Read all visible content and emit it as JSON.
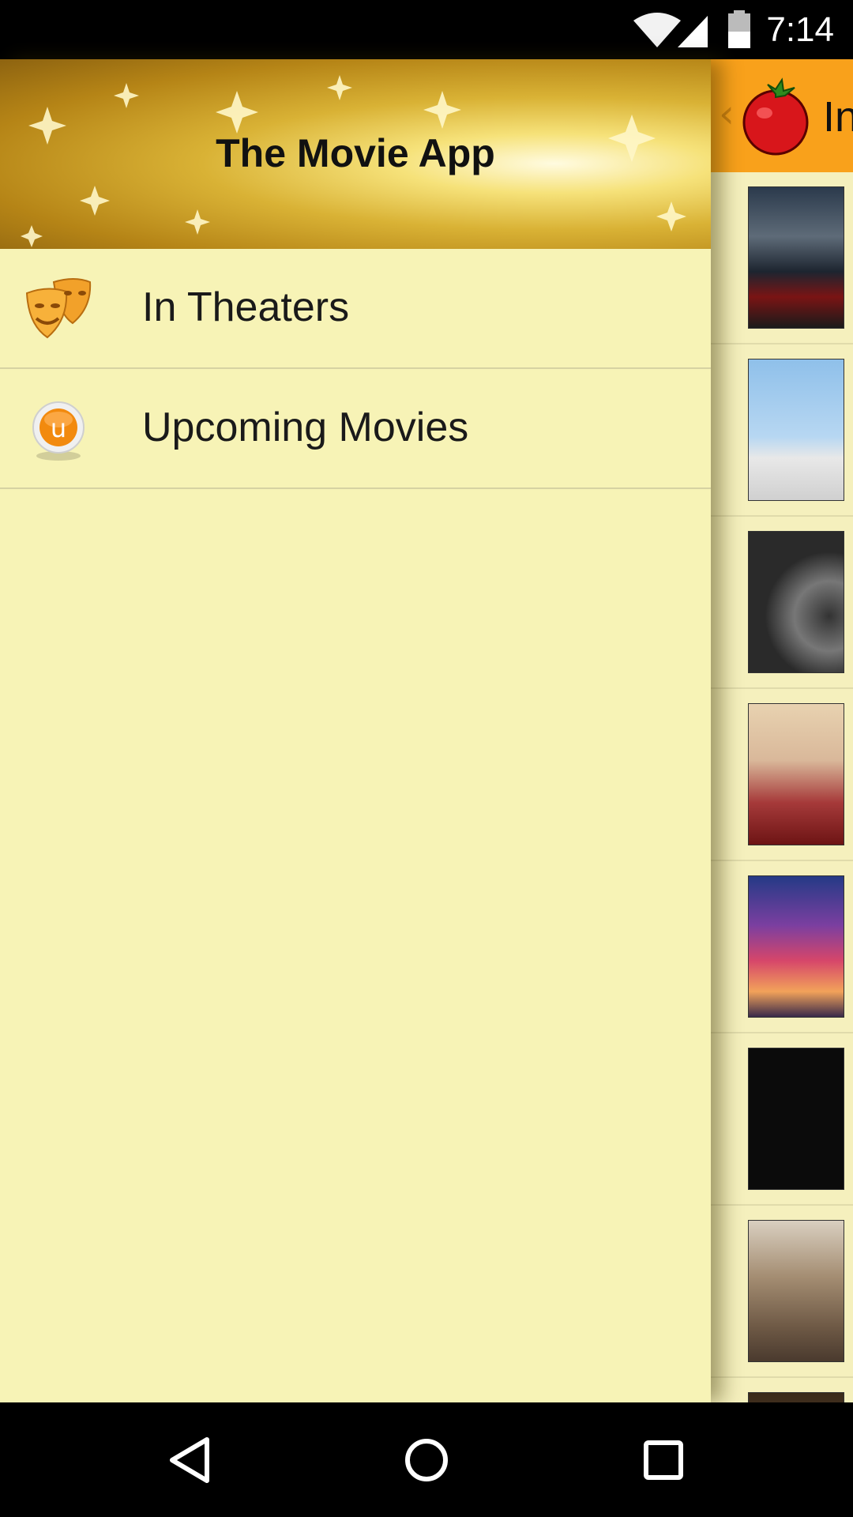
{
  "status_bar": {
    "time": "7:14",
    "icons": [
      "wifi-icon",
      "cell-signal-icon",
      "battery-icon"
    ]
  },
  "drawer": {
    "title": "The Movie App",
    "items": [
      {
        "label": "In Theaters",
        "icon": "theater-masks-icon"
      },
      {
        "label": "Upcoming Movies",
        "icon": "upcoming-u-icon"
      }
    ]
  },
  "background_app": {
    "toolbar_title": "In",
    "logo": "tomato-logo-icon",
    "posters": [
      "movie-poster-1",
      "movie-poster-2",
      "movie-poster-3",
      "movie-poster-4",
      "movie-poster-5",
      "movie-poster-6",
      "movie-poster-7",
      "movie-poster-8"
    ]
  },
  "nav_bar": {
    "buttons": [
      "back-icon",
      "home-icon",
      "recents-icon"
    ]
  },
  "colors": {
    "drawer_bg": "#f7f3b6",
    "toolbar_accent": "#f9a11b",
    "header_gold": "#d9b235"
  }
}
